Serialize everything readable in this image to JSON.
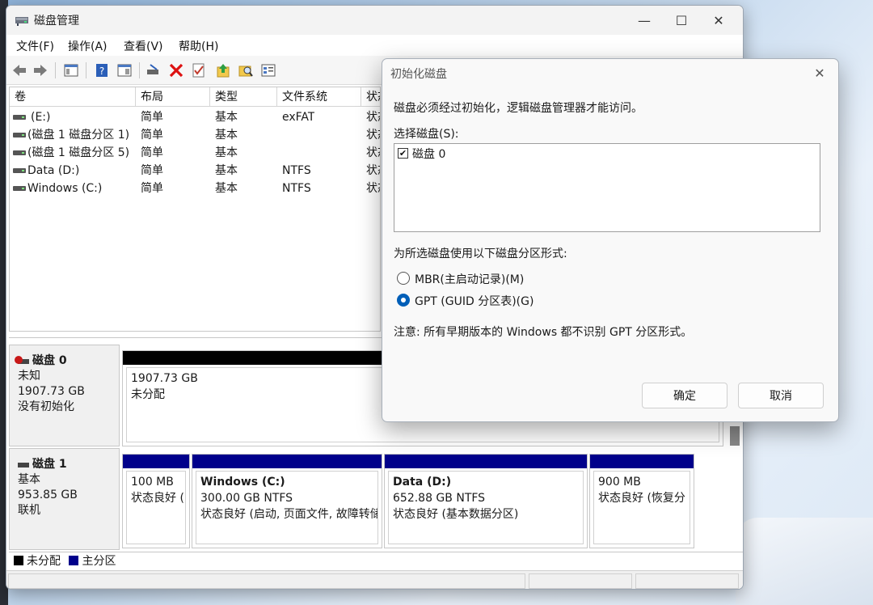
{
  "window": {
    "title": "磁盘管理",
    "minimize": "—",
    "maximize": "☐",
    "close": "✕"
  },
  "menu": [
    "文件(F)",
    "操作(A)",
    "查看(V)",
    "帮助(H)"
  ],
  "volume_list": {
    "columns": [
      "卷",
      "布局",
      "类型",
      "文件系统",
      "状态"
    ],
    "rows": [
      {
        "name": "(E:)",
        "layout": "简单",
        "type": "基本",
        "fs": "exFAT",
        "status": "状态"
      },
      {
        "name": "(磁盘 1 磁盘分区 1)",
        "layout": "简单",
        "type": "基本",
        "fs": "",
        "status": "状态"
      },
      {
        "name": "(磁盘 1 磁盘分区 5)",
        "layout": "简单",
        "type": "基本",
        "fs": "",
        "status": "状态"
      },
      {
        "name": "Data (D:)",
        "layout": "简单",
        "type": "基本",
        "fs": "NTFS",
        "status": "状态"
      },
      {
        "name": "Windows (C:)",
        "layout": "简单",
        "type": "基本",
        "fs": "NTFS",
        "status": "状态"
      }
    ]
  },
  "disks": [
    {
      "name": "磁盘 0",
      "lines": [
        "未知",
        "1907.73 GB",
        "没有初始化"
      ],
      "partitions": [
        {
          "title": "",
          "line1": "1907.73 GB",
          "line2": "未分配",
          "color": "#000000"
        }
      ]
    },
    {
      "name": "磁盘 1",
      "lines": [
        "基本",
        "953.85 GB",
        "联机"
      ],
      "partitions": [
        {
          "title": "",
          "line1": "100 MB",
          "line2": "状态良好 (",
          "color": "#00008b"
        },
        {
          "title": "Windows  (C:)",
          "line1": "300.00 GB NTFS",
          "line2": "状态良好 (启动, 页面文件, 故障转储",
          "color": "#00008b"
        },
        {
          "title": "Data  (D:)",
          "line1": "652.88 GB NTFS",
          "line2": "状态良好 (基本数据分区)",
          "color": "#00008b"
        },
        {
          "title": "",
          "line1": "900 MB",
          "line2": "状态良好 (恢复分",
          "color": "#00008b"
        }
      ]
    }
  ],
  "legend": [
    {
      "label": "未分配",
      "color": "#000000"
    },
    {
      "label": "主分区",
      "color": "#00008b"
    }
  ],
  "dialog": {
    "title": "初始化磁盘",
    "close": "✕",
    "message": "磁盘必须经过初始化，逻辑磁盘管理器才能访问。",
    "select_label": "选择磁盘(S):",
    "disk_item": "磁盘 0",
    "partition_style_label": "为所选磁盘使用以下磁盘分区形式:",
    "option_mbr": "MBR(主启动记录)(M)",
    "option_gpt": "GPT (GUID 分区表)(G)",
    "selected_option": "gpt",
    "note": "注意: 所有早期版本的 Windows 都不识别 GPT 分区形式。",
    "ok": "确定",
    "cancel": "取消"
  },
  "colors": {
    "accent": "#005fb8",
    "unallocated": "#000000",
    "primary_partition": "#00008b"
  }
}
